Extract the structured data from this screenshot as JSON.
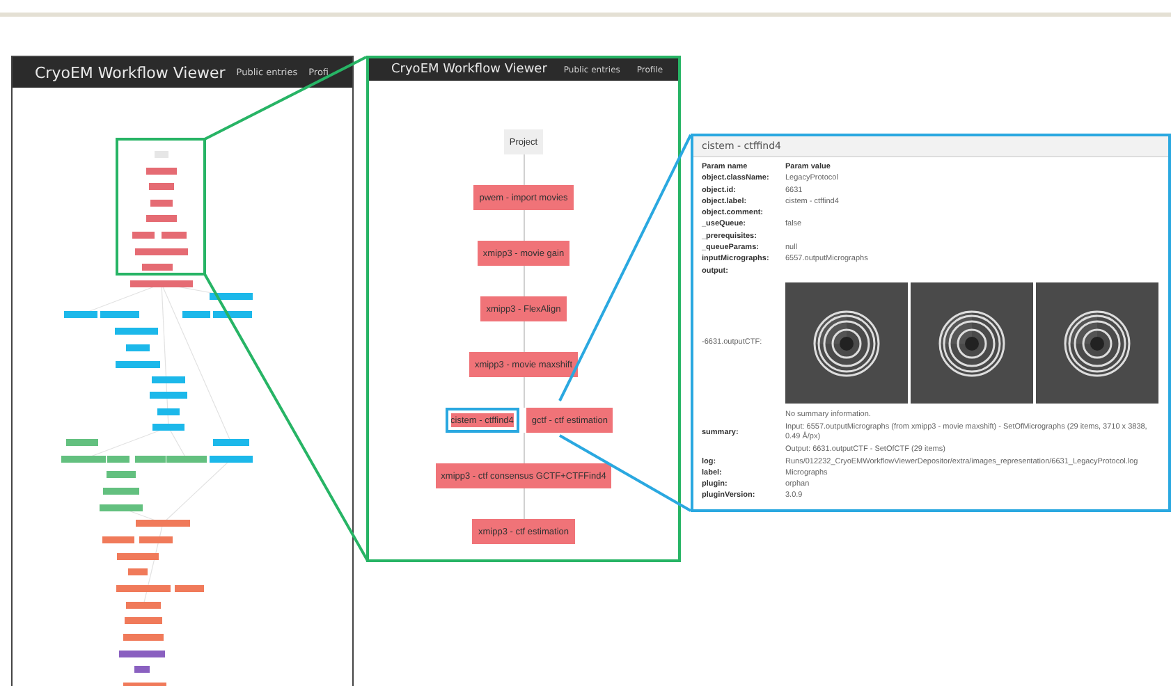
{
  "overview_panel": {
    "header": {
      "title": "CryoEM Workflow Viewer",
      "links": [
        "Public entries",
        "Profi"
      ]
    }
  },
  "zoom_panel": {
    "header": {
      "title": "CryoEM Workflow Viewer",
      "links": [
        "Public entries",
        "Profile"
      ]
    },
    "node_rows": [
      [
        {
          "label": "Project",
          "color": "#eeeeee",
          "selected": false
        }
      ],
      [
        {
          "label": "pwem - import movies",
          "color": "#f07378",
          "selected": false
        }
      ],
      [
        {
          "label": "xmipp3 - movie gain",
          "color": "#f07378",
          "selected": false
        }
      ],
      [
        {
          "label": "xmipp3 - FlexAlign",
          "color": "#f07378",
          "selected": false
        }
      ],
      [
        {
          "label": "xmipp3 - movie maxshift",
          "color": "#f07378",
          "selected": false
        }
      ],
      [
        {
          "label": "cistem - ctffind4",
          "color": "#f07378",
          "selected": true
        },
        {
          "label": "gctf - ctf estimation",
          "color": "#f07378",
          "selected": false
        }
      ],
      [
        {
          "label": "xmipp3 - ctf consensus GCTF+CTFFind4",
          "color": "#f07378",
          "selected": false
        }
      ],
      [
        {
          "label": "xmipp3 - ctf estimation",
          "color": "#f07378",
          "selected": false
        }
      ]
    ]
  },
  "detail_panel": {
    "title": "cistem - ctffind4",
    "columns": [
      "Param name",
      "Param value"
    ],
    "params": [
      {
        "kind": "text",
        "name": "object.className:",
        "value": "LegacyProtocol"
      },
      {
        "kind": "text",
        "name": "object.id:",
        "value": "6631"
      },
      {
        "kind": "text",
        "name": "object.label:",
        "value": "cistem - ctffind4"
      },
      {
        "kind": "text",
        "name": "object.comment:"
      },
      {
        "kind": "text",
        "name": "_useQueue:",
        "value": "false"
      },
      {
        "kind": "text",
        "name": "_prerequisites:"
      },
      {
        "kind": "text",
        "name": "_queueParams:",
        "value": "null"
      },
      {
        "kind": "text",
        "name": "inputMicrographs:",
        "value": "6557.outputMicrographs"
      },
      {
        "kind": "text",
        "name": "output:"
      },
      {
        "kind": "images",
        "name": "-6631.outputCTF:"
      },
      {
        "kind": "lines",
        "name": "summary:",
        "lines": [
          "No summary information.",
          "Input: 6557.outputMicrographs (from xmipp3 - movie maxshift) - SetOfMicrographs (29 items, 3710 x 3838, 0.49 Å/px)",
          "Output: 6631.outputCTF - SetOfCTF (29 items)"
        ]
      },
      {
        "kind": "text",
        "name": "log:",
        "value": "Runs/012232_CryoEMWorkflowViewerDepositor/extra/images_representation/6631_LegacyProtocol.log"
      },
      {
        "kind": "text",
        "name": "label:",
        "value": "Micrographs"
      },
      {
        "kind": "text",
        "name": "plugin:",
        "value": "orphan"
      },
      {
        "kind": "text",
        "name": "pluginVersion:",
        "value": "3.0.9"
      }
    ]
  }
}
